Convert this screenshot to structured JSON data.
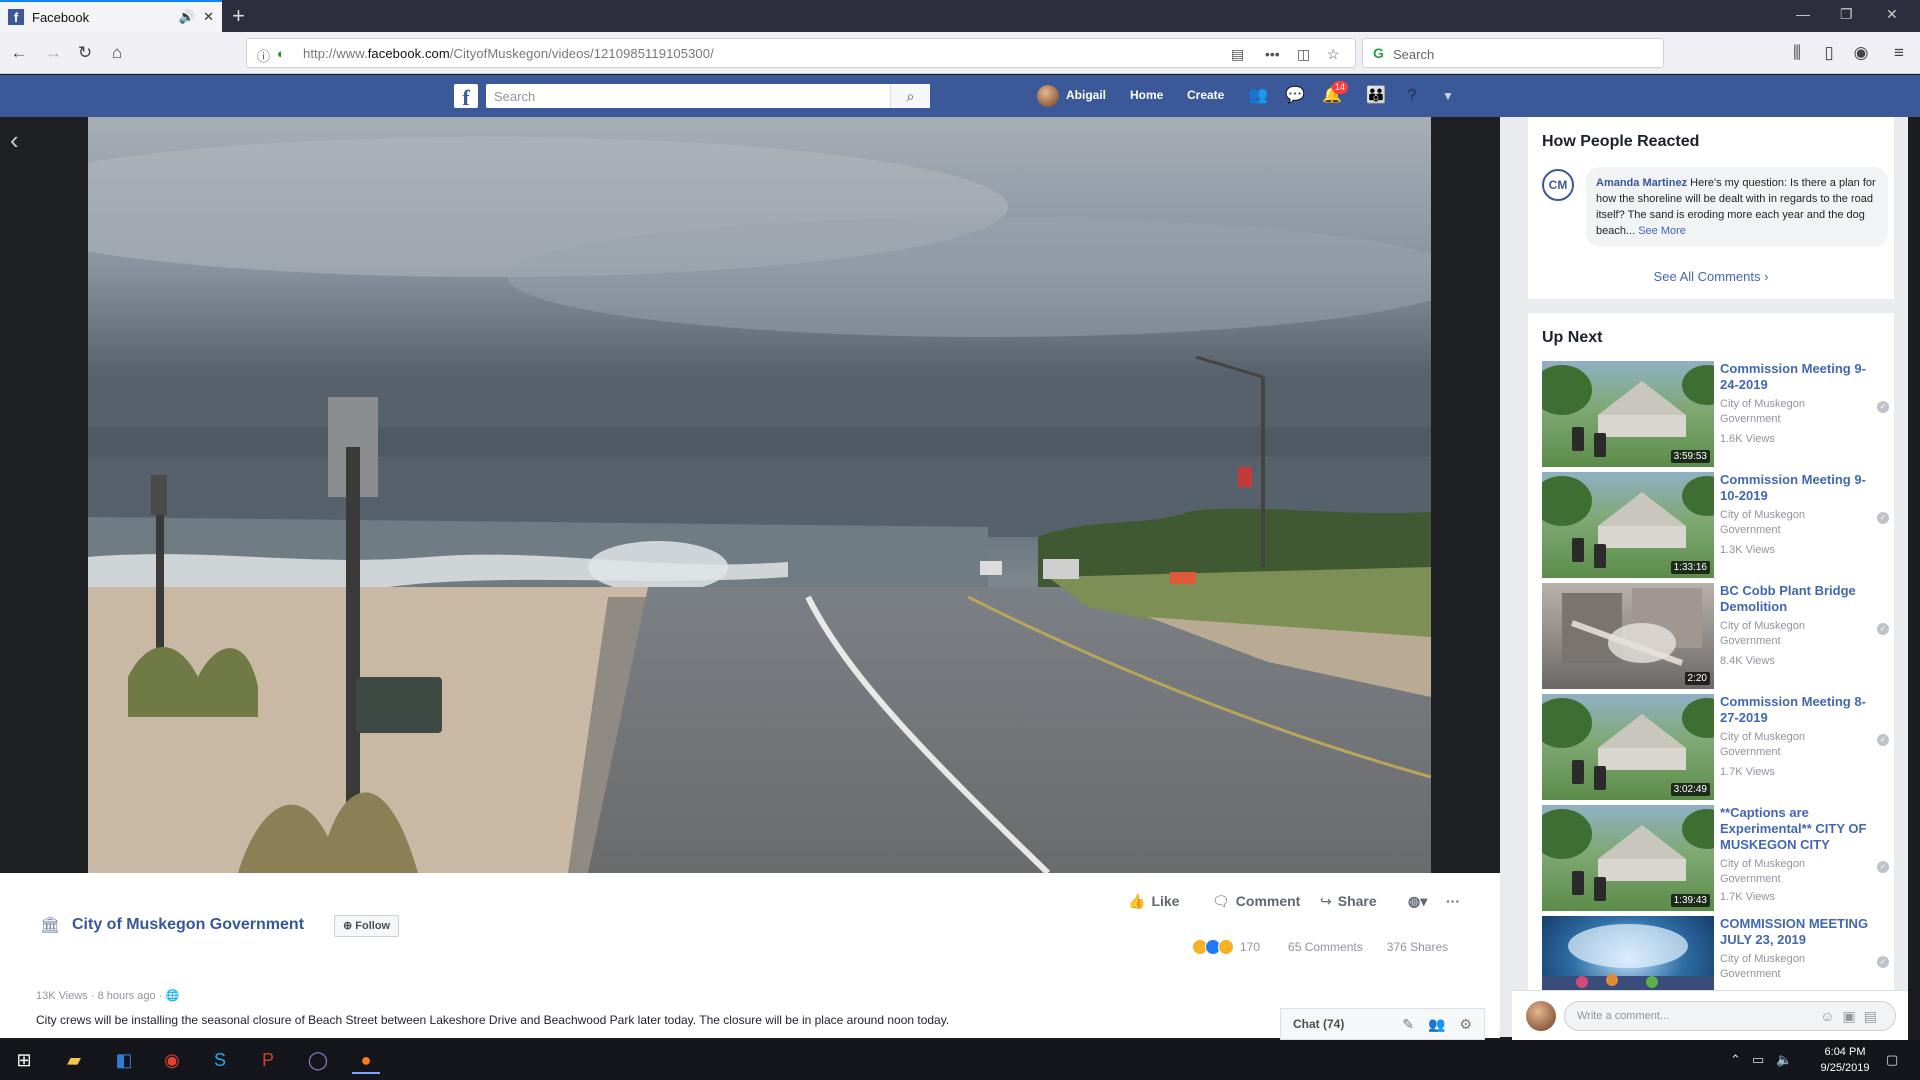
{
  "browser": {
    "tab_title": "Facebook",
    "url_prefix": "http://www.",
    "url_domain": "facebook.com",
    "url_path": "/CityofMuskegon/videos/1210985119105300/",
    "search_placeholder": "Search"
  },
  "fb": {
    "search_placeholder": "Search",
    "user_name": "Abigail",
    "nav_home": "Home",
    "nav_create": "Create",
    "notif_badge": "14"
  },
  "video": {
    "page_name": "City of Muskegon Government",
    "follow_label": "Follow",
    "like_label": "Like",
    "comment_label": "Comment",
    "share_label": "Share",
    "reaction_count": "170",
    "comments_count": "65 Comments",
    "shares_count": "376 Shares",
    "views": "13K Views",
    "time_ago": "8 hours ago",
    "description": "City crews will be installing the seasonal closure of Beach Street between Lakeshore Drive and Beachwood Park later today. The closure will be in place around noon today."
  },
  "reactions": {
    "heading": "How People Reacted",
    "comment_author": "Amanda Martinez",
    "comment_text": "Here's my question: Is there a plan for how the shoreline will be dealt with in regards to the road itself? The sand is eroding more each year and the dog beach...",
    "see_more": "See More",
    "see_all": "See All Comments"
  },
  "up_next": {
    "heading": "Up Next",
    "items": [
      {
        "title": "Commission Meeting 9-24-2019",
        "channel": "City of Muskegon Government",
        "views": "1.6K Views",
        "duration": "3:59:53"
      },
      {
        "title": "Commission Meeting 9-10-2019",
        "channel": "City of Muskegon Government",
        "views": "1.3K Views",
        "duration": "1:33:16"
      },
      {
        "title": "BC Cobb Plant Bridge Demolition",
        "channel": "City of Muskegon Government",
        "views": "8.4K Views",
        "duration": "2:20"
      },
      {
        "title": "Commission Meeting 8-27-2019",
        "channel": "City of Muskegon Government",
        "views": "1.7K Views",
        "duration": "3:02:49"
      },
      {
        "title": "**Captions are Experimental** CITY OF MUSKEGON CITY",
        "channel": "City of Muskegon Government",
        "views": "1.7K Views",
        "duration": "1:39:43"
      },
      {
        "title": "COMMISSION MEETING JULY 23, 2019",
        "channel": "City of Muskegon Government",
        "views": "",
        "duration": ""
      }
    ]
  },
  "comment_box": {
    "placeholder": "Write a comment..."
  },
  "chat": {
    "label": "Chat (74)"
  },
  "taskbar": {
    "time": "6:04 PM",
    "date": "9/25/2019"
  }
}
